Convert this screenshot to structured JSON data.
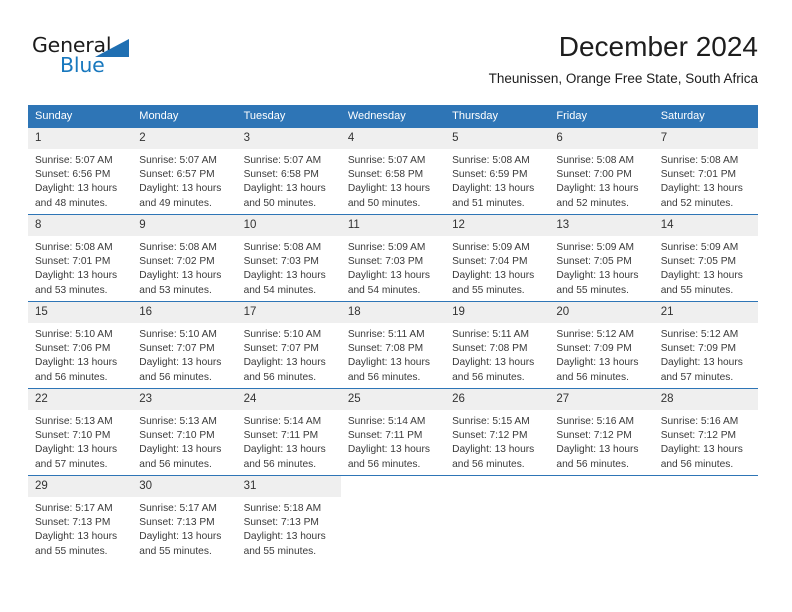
{
  "brand": {
    "name_top": "General",
    "name_bottom": "Blue",
    "triangle_color": "#1f6fb2",
    "blue_text_color": "#1878be"
  },
  "header": {
    "month_title": "December 2024",
    "location": "Theunissen, Orange Free State, South Africa"
  },
  "theme": {
    "header_blue": "#2e75b6",
    "daynum_gray": "#efefef",
    "text_color": "#3a3a3a"
  },
  "calendar": {
    "weekday_headers": [
      "Sunday",
      "Monday",
      "Tuesday",
      "Wednesday",
      "Thursday",
      "Friday",
      "Saturday"
    ],
    "weeks": [
      [
        {
          "day": "1",
          "sunrise": "Sunrise: 5:07 AM",
          "sunset": "Sunset: 6:56 PM",
          "daylight": "Daylight: 13 hours and 48 minutes."
        },
        {
          "day": "2",
          "sunrise": "Sunrise: 5:07 AM",
          "sunset": "Sunset: 6:57 PM",
          "daylight": "Daylight: 13 hours and 49 minutes."
        },
        {
          "day": "3",
          "sunrise": "Sunrise: 5:07 AM",
          "sunset": "Sunset: 6:58 PM",
          "daylight": "Daylight: 13 hours and 50 minutes."
        },
        {
          "day": "4",
          "sunrise": "Sunrise: 5:07 AM",
          "sunset": "Sunset: 6:58 PM",
          "daylight": "Daylight: 13 hours and 50 minutes."
        },
        {
          "day": "5",
          "sunrise": "Sunrise: 5:08 AM",
          "sunset": "Sunset: 6:59 PM",
          "daylight": "Daylight: 13 hours and 51 minutes."
        },
        {
          "day": "6",
          "sunrise": "Sunrise: 5:08 AM",
          "sunset": "Sunset: 7:00 PM",
          "daylight": "Daylight: 13 hours and 52 minutes."
        },
        {
          "day": "7",
          "sunrise": "Sunrise: 5:08 AM",
          "sunset": "Sunset: 7:01 PM",
          "daylight": "Daylight: 13 hours and 52 minutes."
        }
      ],
      [
        {
          "day": "8",
          "sunrise": "Sunrise: 5:08 AM",
          "sunset": "Sunset: 7:01 PM",
          "daylight": "Daylight: 13 hours and 53 minutes."
        },
        {
          "day": "9",
          "sunrise": "Sunrise: 5:08 AM",
          "sunset": "Sunset: 7:02 PM",
          "daylight": "Daylight: 13 hours and 53 minutes."
        },
        {
          "day": "10",
          "sunrise": "Sunrise: 5:08 AM",
          "sunset": "Sunset: 7:03 PM",
          "daylight": "Daylight: 13 hours and 54 minutes."
        },
        {
          "day": "11",
          "sunrise": "Sunrise: 5:09 AM",
          "sunset": "Sunset: 7:03 PM",
          "daylight": "Daylight: 13 hours and 54 minutes."
        },
        {
          "day": "12",
          "sunrise": "Sunrise: 5:09 AM",
          "sunset": "Sunset: 7:04 PM",
          "daylight": "Daylight: 13 hours and 55 minutes."
        },
        {
          "day": "13",
          "sunrise": "Sunrise: 5:09 AM",
          "sunset": "Sunset: 7:05 PM",
          "daylight": "Daylight: 13 hours and 55 minutes."
        },
        {
          "day": "14",
          "sunrise": "Sunrise: 5:09 AM",
          "sunset": "Sunset: 7:05 PM",
          "daylight": "Daylight: 13 hours and 55 minutes."
        }
      ],
      [
        {
          "day": "15",
          "sunrise": "Sunrise: 5:10 AM",
          "sunset": "Sunset: 7:06 PM",
          "daylight": "Daylight: 13 hours and 56 minutes."
        },
        {
          "day": "16",
          "sunrise": "Sunrise: 5:10 AM",
          "sunset": "Sunset: 7:07 PM",
          "daylight": "Daylight: 13 hours and 56 minutes."
        },
        {
          "day": "17",
          "sunrise": "Sunrise: 5:10 AM",
          "sunset": "Sunset: 7:07 PM",
          "daylight": "Daylight: 13 hours and 56 minutes."
        },
        {
          "day": "18",
          "sunrise": "Sunrise: 5:11 AM",
          "sunset": "Sunset: 7:08 PM",
          "daylight": "Daylight: 13 hours and 56 minutes."
        },
        {
          "day": "19",
          "sunrise": "Sunrise: 5:11 AM",
          "sunset": "Sunset: 7:08 PM",
          "daylight": "Daylight: 13 hours and 56 minutes."
        },
        {
          "day": "20",
          "sunrise": "Sunrise: 5:12 AM",
          "sunset": "Sunset: 7:09 PM",
          "daylight": "Daylight: 13 hours and 56 minutes."
        },
        {
          "day": "21",
          "sunrise": "Sunrise: 5:12 AM",
          "sunset": "Sunset: 7:09 PM",
          "daylight": "Daylight: 13 hours and 57 minutes."
        }
      ],
      [
        {
          "day": "22",
          "sunrise": "Sunrise: 5:13 AM",
          "sunset": "Sunset: 7:10 PM",
          "daylight": "Daylight: 13 hours and 57 minutes."
        },
        {
          "day": "23",
          "sunrise": "Sunrise: 5:13 AM",
          "sunset": "Sunset: 7:10 PM",
          "daylight": "Daylight: 13 hours and 56 minutes."
        },
        {
          "day": "24",
          "sunrise": "Sunrise: 5:14 AM",
          "sunset": "Sunset: 7:11 PM",
          "daylight": "Daylight: 13 hours and 56 minutes."
        },
        {
          "day": "25",
          "sunrise": "Sunrise: 5:14 AM",
          "sunset": "Sunset: 7:11 PM",
          "daylight": "Daylight: 13 hours and 56 minutes."
        },
        {
          "day": "26",
          "sunrise": "Sunrise: 5:15 AM",
          "sunset": "Sunset: 7:12 PM",
          "daylight": "Daylight: 13 hours and 56 minutes."
        },
        {
          "day": "27",
          "sunrise": "Sunrise: 5:16 AM",
          "sunset": "Sunset: 7:12 PM",
          "daylight": "Daylight: 13 hours and 56 minutes."
        },
        {
          "day": "28",
          "sunrise": "Sunrise: 5:16 AM",
          "sunset": "Sunset: 7:12 PM",
          "daylight": "Daylight: 13 hours and 56 minutes."
        }
      ],
      [
        {
          "day": "29",
          "sunrise": "Sunrise: 5:17 AM",
          "sunset": "Sunset: 7:13 PM",
          "daylight": "Daylight: 13 hours and 55 minutes."
        },
        {
          "day": "30",
          "sunrise": "Sunrise: 5:17 AM",
          "sunset": "Sunset: 7:13 PM",
          "daylight": "Daylight: 13 hours and 55 minutes."
        },
        {
          "day": "31",
          "sunrise": "Sunrise: 5:18 AM",
          "sunset": "Sunset: 7:13 PM",
          "daylight": "Daylight: 13 hours and 55 minutes."
        },
        {
          "day": "",
          "sunrise": "",
          "sunset": "",
          "daylight": ""
        },
        {
          "day": "",
          "sunrise": "",
          "sunset": "",
          "daylight": ""
        },
        {
          "day": "",
          "sunrise": "",
          "sunset": "",
          "daylight": ""
        },
        {
          "day": "",
          "sunrise": "",
          "sunset": "",
          "daylight": ""
        }
      ]
    ]
  }
}
